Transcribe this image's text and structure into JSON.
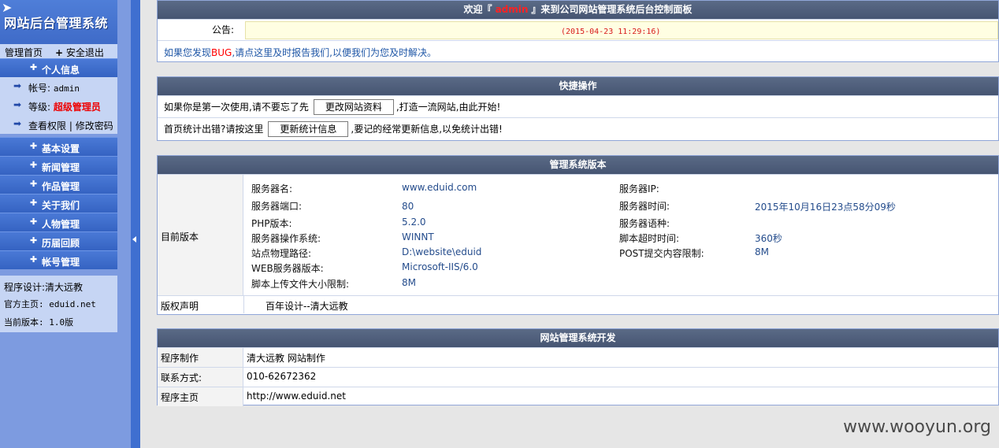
{
  "sidebar": {
    "logo_title": "网站后台管理系统",
    "top_links": {
      "home": "管理首页",
      "logout": "安全退出"
    },
    "personal": {
      "header": "个人信息",
      "account_label": "帐号:",
      "account_value": "admin",
      "level_label": "等级:",
      "level_value": "超级管理员",
      "permission_link": "查看权限",
      "password_link": "修改密码"
    },
    "menu_items": [
      "基本设置",
      "新闻管理",
      "作品管理",
      "关于我们",
      "人物管理",
      "历届回顾",
      "帐号管理"
    ],
    "credits": {
      "designer": "程序设计:清大远教",
      "homepage": "官方主页: eduid.net",
      "version": "当前版本: 1.0版"
    }
  },
  "welcome": {
    "prefix": "欢迎『",
    "user": "admin",
    "suffix": "』来到公司网站管理系统后台控制面板",
    "notice_label": "公告:",
    "notice_date": "(2015-04-23 11:29:16)",
    "bug_text_1": "如果您发现",
    "bug_word": "BUG",
    "bug_text_2": ",请点这里及时报告我们,以便我们为您及时解决。"
  },
  "quick": {
    "header": "快捷操作",
    "row1_before": "如果你是第一次使用,请不要忘了先",
    "row1_button": "更改网站资料",
    "row1_after": ",打造一流网站,由此开始!",
    "row2_before": "首页统计出错?请按这里",
    "row2_button": "更新统计信息",
    "row2_after": ",要记的经常更新信息,以免统计出错!"
  },
  "version": {
    "header": "管理系统版本",
    "current_label": "目前版本",
    "server_name_label": "服务器名:",
    "server_name": "www.eduid.com",
    "server_ip_label": "服务器IP:",
    "server_ip": "",
    "server_port_label": "服务器端口:",
    "server_port": "80",
    "server_time_label": "服务器时间:",
    "server_time": "2015年10月16日23点58分09秒",
    "php_label": "PHP版本:",
    "php": "5.2.0",
    "lang_label": "服务器语种:",
    "lang": "",
    "os_label": "服务器操作系统:",
    "os": "WINNT",
    "timeout_label": "脚本超时时间:",
    "timeout": "360秒",
    "path_label": "站点物理路径:",
    "path": "D:\\website\\eduid",
    "post_label": "POST提交内容限制:",
    "post": "8M",
    "web_label": "WEB服务器版本:",
    "web": "Microsoft-IIS/6.0",
    "upload_label": "脚本上传文件大小限制:",
    "upload": "8M",
    "copyright_label": "版权声明",
    "copyright": "百年设计--清大远教"
  },
  "dev": {
    "header": "网站管理系统开发",
    "rows": [
      {
        "k": "程序制作",
        "v": "清大远教 网站制作"
      },
      {
        "k": "联系方式:",
        "v": "010-62672362"
      },
      {
        "k": "程序主页",
        "v": "http://www.eduid.net"
      }
    ]
  },
  "watermark": "www.wooyun.org"
}
